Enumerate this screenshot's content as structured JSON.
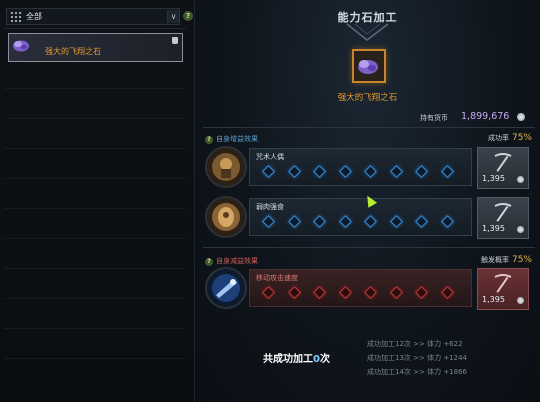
{
  "filter": {
    "label": "全部",
    "arrow": "∨",
    "help": "?"
  },
  "left_list": {
    "items": [
      {
        "name": "强大的飞翔之石"
      }
    ]
  },
  "panel": {
    "title": "能力石加工",
    "selected_item_name": "强大的飞翔之石",
    "currency_label": "持有货币",
    "currency_value": "1,899,676"
  },
  "sections": [
    {
      "heading": "自身增益效果",
      "rate_label": "成功率",
      "rate_value": "75%"
    },
    {
      "heading": "自身减益效果",
      "rate_label": "触发概率",
      "rate_value": "75%"
    }
  ],
  "rows": [
    {
      "name": "咒术人偶",
      "cost": "1,395",
      "gems": 8,
      "style": "blue"
    },
    {
      "name": "弱肉强食",
      "cost": "1,395",
      "gems": 8,
      "style": "blue"
    },
    {
      "name": "移动攻击速度",
      "cost": "1,395",
      "gems": 8,
      "style": "red"
    }
  ],
  "summary": {
    "prefix": "共成功加工",
    "count": "0",
    "suffix": "次",
    "bonuses": [
      "成功加工12次 >> 体力 +622",
      "成功加工13次 >> 体力 +1244",
      "成功加工14次 >> 体力 +1866"
    ]
  },
  "colors": {
    "accent_orange": "#e79a2f",
    "rate_gold": "#e0b448",
    "gem_blue": "#3a8ed8",
    "gem_red": "#c23a3c"
  },
  "icons": [
    "grid-icon",
    "help-icon",
    "bag-icon",
    "stone-icon",
    "coin-icon",
    "pickaxe-icon"
  ]
}
